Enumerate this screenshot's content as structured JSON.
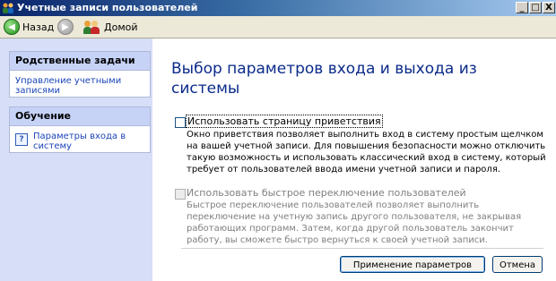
{
  "window": {
    "title": "Учетные записи пользователей",
    "controls": {
      "minimize": "_",
      "maximize": "□",
      "close": "X"
    }
  },
  "toolbar": {
    "back_label": "Назад",
    "home_label": "Домой"
  },
  "sidebar": {
    "related_tasks": {
      "title": "Родственные задачи",
      "items": [
        {
          "label": "Управление учетными записями"
        }
      ]
    },
    "learn": {
      "title": "Обучение",
      "items": [
        {
          "label": "Параметры входа в систему"
        }
      ]
    }
  },
  "main": {
    "title": "Выбор параметров входа и выхода из системы",
    "options": [
      {
        "label": "Использовать страницу приветствия",
        "checked": false,
        "enabled": true,
        "description": "Окно приветствия позволяет выполнить вход в систему простым щелчком на вашей учетной записи. Для повышения безопасности можно отключить такую возможность и использовать классический вход в систему, который требует от пользователей ввода имени учетной записи и пароля."
      },
      {
        "label": "Использовать быстрое переключение пользователей",
        "checked": false,
        "enabled": false,
        "description": "Быстрое переключение пользователей позволяет выполнить переключение на учетную запись другого пользователя, не закрывая работающих программ. Затем, когда другой пользователь закончит работу, вы сможете быстро вернуться к своей учетной записи."
      }
    ],
    "apply_label": "Применение параметров",
    "cancel_label": "Отмена"
  },
  "colors": {
    "titlebar": "#0a246a",
    "sidebar_bg": "#d6dff7",
    "link": "#1b45b8",
    "heading": "#0b2b8a"
  }
}
